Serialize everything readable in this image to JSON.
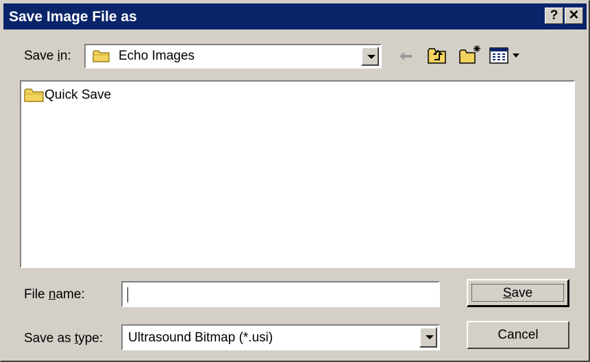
{
  "window": {
    "title": "Save Image File as",
    "help_button": "?",
    "close_button": "✕"
  },
  "save_in": {
    "label_prefix": "Save ",
    "label_accel": "i",
    "label_suffix": "n:",
    "value": "Echo Images"
  },
  "toolbar": {
    "back_icon": "back-arrow-icon",
    "up_icon": "up-one-level-icon",
    "new_folder_icon": "new-folder-icon",
    "view_menu_icon": "view-menu-icon"
  },
  "file_list": {
    "items": [
      {
        "label": "Quick Save",
        "icon": "folder-icon"
      }
    ]
  },
  "file_name": {
    "label_prefix": "File ",
    "label_accel": "n",
    "label_suffix": "ame:",
    "value": "",
    "placeholder": ""
  },
  "save_as_type": {
    "label_prefix": "Save as ",
    "label_accel": "t",
    "label_suffix": "ype:",
    "value": "Ultrasound Bitmap (*.usi)"
  },
  "buttons": {
    "save_accel": "S",
    "save_rest": "ave",
    "cancel": "Cancel"
  },
  "colors": {
    "titlebar": "#0a246a",
    "face": "#d4d0c8",
    "folder": "#f2d35e"
  }
}
